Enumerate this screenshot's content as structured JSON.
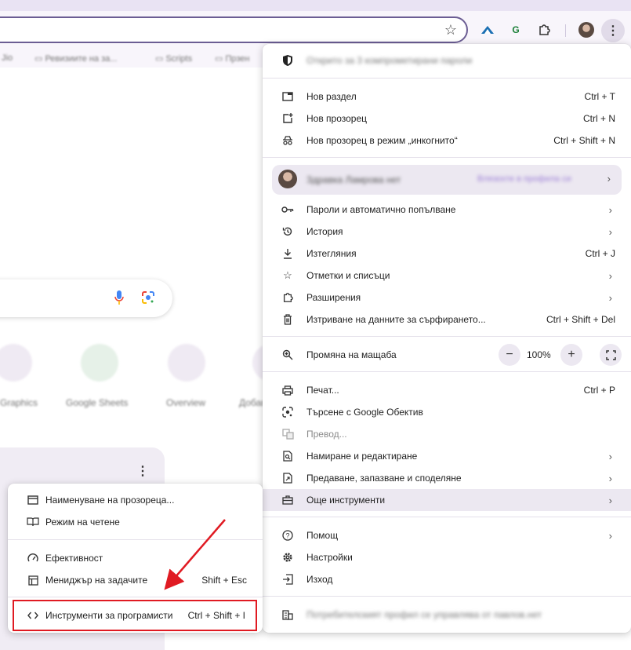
{
  "toolbar": {
    "bookmarks": [
      "Jio",
      "Ревизиите на за...",
      "Scripts",
      "Прзен"
    ],
    "ext_g_label": "G"
  },
  "shortcuts": [
    "Graphics",
    "Google Sheets",
    "Overview",
    "Добав"
  ],
  "main_menu": {
    "header": "Открито за 3 компрометирани пароли",
    "items": [
      {
        "icon": "new-tab-icon",
        "label": "Нов раздел",
        "shortcut": "Ctrl + T"
      },
      {
        "icon": "new-window-icon",
        "label": "Нов прозорец",
        "shortcut": "Ctrl + N"
      },
      {
        "icon": "incognito-icon",
        "label": "Нов прозорец в режим „инкогнито“",
        "shortcut": "Ctrl + Shift + N"
      }
    ],
    "profile": {
      "name": "Здравка Ламрова нет",
      "signin": "Влязохте в профила си"
    },
    "items2": [
      {
        "icon": "key-icon",
        "label": "Пароли и автоматично попълване",
        "arrow": true
      },
      {
        "icon": "history-icon",
        "label": "История",
        "arrow": true
      },
      {
        "icon": "download-icon",
        "label": "Изтегляния",
        "shortcut": "Ctrl + J"
      },
      {
        "icon": "star-icon",
        "label": "Отметки и списъци",
        "arrow": true
      },
      {
        "icon": "puzzle-icon",
        "label": "Разширения",
        "arrow": true
      },
      {
        "icon": "trash-icon",
        "label": "Изтриване на данните за сърфирането...",
        "shortcut": "Ctrl + Shift + Del"
      }
    ],
    "zoom": {
      "label": "Промяна на мащаба",
      "minus": "−",
      "value": "100%",
      "plus": "+"
    },
    "items3": [
      {
        "icon": "print-icon",
        "label": "Печат...",
        "shortcut": "Ctrl + P"
      },
      {
        "icon": "lens-icon",
        "label": "Търсене с Google Обектив"
      },
      {
        "icon": "translate-icon",
        "label": "Превод..."
      },
      {
        "icon": "find-icon",
        "label": "Намиране и редактиране",
        "arrow": true
      },
      {
        "icon": "cast-icon",
        "label": "Предаване, запазване и споделяне",
        "arrow": true
      },
      {
        "icon": "toolbox-icon",
        "label": "Още инструменти",
        "arrow": true
      }
    ],
    "items4": [
      {
        "icon": "help-icon",
        "label": "Помощ",
        "arrow": true
      },
      {
        "icon": "settings-icon",
        "label": "Настройки"
      },
      {
        "icon": "exit-icon",
        "label": "Изход"
      }
    ],
    "managed": "Потребителският профил се управлява от павлов.нет"
  },
  "sub_menu": {
    "items": [
      {
        "icon": "window-icon",
        "label": "Наименуване на прозореца..."
      },
      {
        "icon": "reading-icon",
        "label": "Режим на четене"
      },
      {
        "icon": "gauge-icon",
        "label": "Ефективност"
      },
      {
        "icon": "task-manager-icon",
        "label": "Мениджър на задачите",
        "shortcut": "Shift + Esc"
      },
      {
        "icon": "code-icon",
        "label": "Инструменти за програмисти",
        "shortcut": "Ctrl + Shift + I"
      }
    ]
  },
  "colors": {
    "accent": "#6b5d93",
    "highlight_red": "#e01a22",
    "menu_hover": "#ece8f1"
  }
}
